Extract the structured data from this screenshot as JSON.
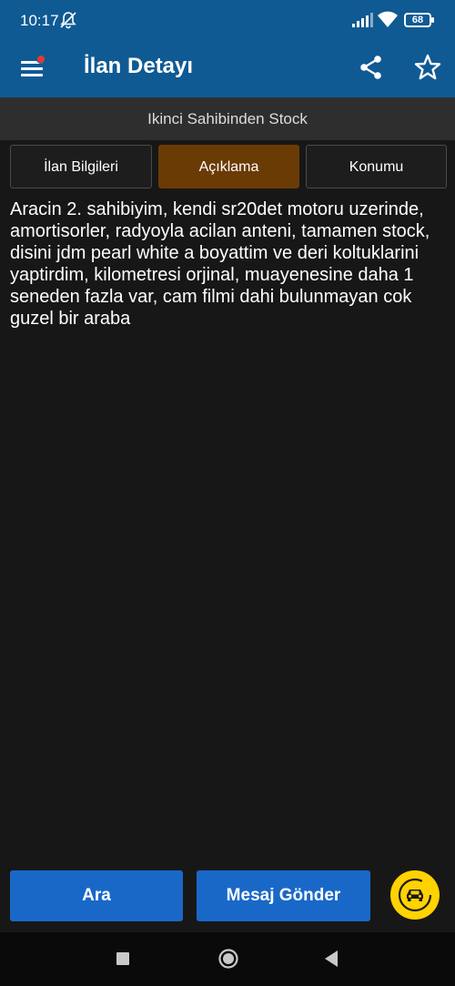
{
  "status_bar": {
    "time": "10:17",
    "battery": "68"
  },
  "app_bar": {
    "title": "İlan Detayı"
  },
  "listing": {
    "title": "Ikinci Sahibinden Stock"
  },
  "tabs": [
    {
      "label": "İlan Bilgileri",
      "active": false
    },
    {
      "label": "Açıklama",
      "active": true
    },
    {
      "label": "Konumu",
      "active": false
    }
  ],
  "description": {
    "text": "Aracin 2. sahibiyim, kendi sr20det motoru uzerinde, amortisorler, radyoyla acilan anteni, tamamen stock, disini jdm pearl white a boyattim ve deri koltuklarini yaptirdim, kilometresi orjinal, muayenesine daha 1 seneden fazla var, cam filmi dahi bulunmayan cok guzel bir araba"
  },
  "actions": {
    "call_label": "Ara",
    "message_label": "Mesaj Gönder"
  },
  "colors": {
    "brand": "#0f5a93",
    "active_tab": "#6b3b06",
    "action_button": "#1968c8",
    "fab": "#ffd200"
  }
}
